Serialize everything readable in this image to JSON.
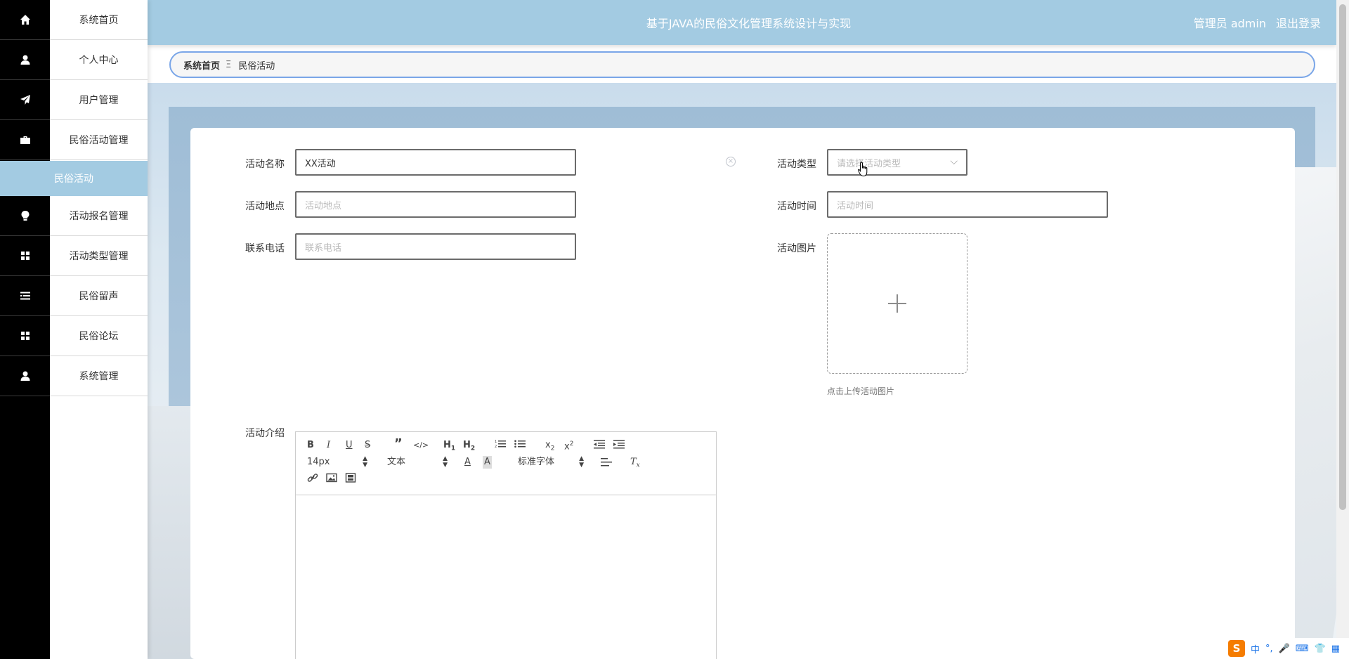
{
  "header": {
    "title": "基于JAVA的民俗文化管理系统设计与实现",
    "user_role": "管理员 admin",
    "logout": "退出登录"
  },
  "sidebar": {
    "items": [
      {
        "label": "系统首页",
        "icon": "home-icon"
      },
      {
        "label": "个人中心",
        "icon": "user-icon"
      },
      {
        "label": "用户管理",
        "icon": "paper-plane-icon"
      },
      {
        "label": "民俗活动管理",
        "icon": "briefcase-icon"
      },
      {
        "label": "活动报名管理",
        "icon": "lightbulb-icon"
      },
      {
        "label": "活动类型管理",
        "icon": "grid-icon"
      },
      {
        "label": "民俗留声",
        "icon": "list-icon"
      },
      {
        "label": "民俗论坛",
        "icon": "grid-icon"
      },
      {
        "label": "系统管理",
        "icon": "user-icon"
      }
    ],
    "active_submenu": "民俗活动"
  },
  "breadcrumb": {
    "home": "系统首页",
    "separator": "Ξ",
    "current": "民俗活动"
  },
  "form": {
    "name": {
      "label": "活动名称",
      "value": "XX活动"
    },
    "type": {
      "label": "活动类型",
      "placeholder": "请选择活动类型"
    },
    "location": {
      "label": "活动地点",
      "placeholder": "活动地点"
    },
    "time": {
      "label": "活动时间",
      "placeholder": "活动时间"
    },
    "phone": {
      "label": "联系电话",
      "placeholder": "联系电话"
    },
    "image": {
      "label": "活动图片",
      "hint": "点击上传活动图片"
    },
    "intro": {
      "label": "活动介绍"
    }
  },
  "editor": {
    "font_size": "14px",
    "block_type": "文本",
    "font_family": "标准字体",
    "buttons_row1": [
      "bold",
      "italic",
      "underline",
      "strike",
      "blockquote",
      "code-block",
      "h1",
      "h2",
      "ordered-list",
      "bullet-list",
      "subscript",
      "superscript",
      "outdent",
      "indent"
    ],
    "buttons_row3": [
      "link",
      "image",
      "video"
    ]
  },
  "ime": {
    "logo": "S",
    "mode": "中"
  },
  "colors": {
    "accent": "#a3cbe2",
    "sidebar_dark": "#000000",
    "breadcrumb_border": "#7aa6e8"
  }
}
